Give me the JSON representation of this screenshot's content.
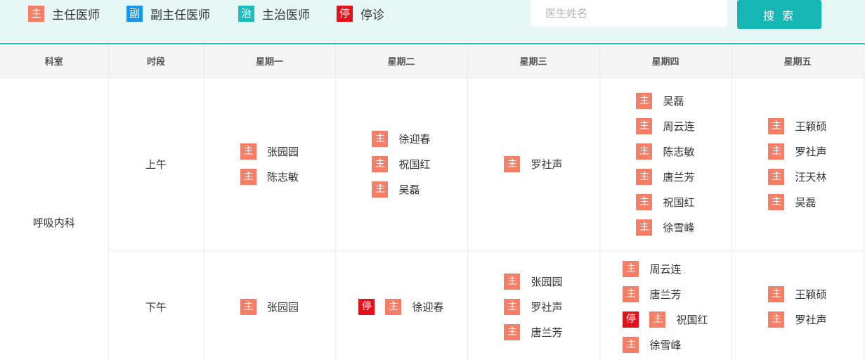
{
  "legend": [
    {
      "badge": "主",
      "label": "主任医师",
      "color": "#f67e66"
    },
    {
      "badge": "副",
      "label": "副主任医师",
      "color": "#1a96e6"
    },
    {
      "badge": "治",
      "label": "主治医师",
      "color": "#1bbdbd"
    },
    {
      "badge": "停",
      "label": "停诊",
      "color": "#e0121a"
    }
  ],
  "search": {
    "placeholder": "医生姓名",
    "value": "",
    "button_label": "搜 索"
  },
  "table": {
    "headers": [
      "科室",
      "时段",
      "星期一",
      "星期二",
      "星期三",
      "星期四",
      "星期五"
    ],
    "department": "呼吸内科",
    "rows": [
      {
        "period": "上午",
        "days": [
          [
            {
              "badges": [
                "主"
              ],
              "name": "张园园"
            },
            {
              "badges": [
                "主"
              ],
              "name": "陈志敏"
            }
          ],
          [
            {
              "badges": [
                "主"
              ],
              "name": "徐迎春"
            },
            {
              "badges": [
                "主"
              ],
              "name": "祝国红"
            },
            {
              "badges": [
                "主"
              ],
              "name": "吴磊"
            }
          ],
          [
            {
              "badges": [
                "主"
              ],
              "name": "罗社声"
            }
          ],
          [
            {
              "badges": [
                "主"
              ],
              "name": "吴磊"
            },
            {
              "badges": [
                "主"
              ],
              "name": "周云连"
            },
            {
              "badges": [
                "主"
              ],
              "name": "陈志敏"
            },
            {
              "badges": [
                "主"
              ],
              "name": "唐兰芳"
            },
            {
              "badges": [
                "主"
              ],
              "name": "祝国红"
            },
            {
              "badges": [
                "主"
              ],
              "name": "徐雪峰"
            }
          ],
          [
            {
              "badges": [
                "主"
              ],
              "name": "王颖硕"
            },
            {
              "badges": [
                "主"
              ],
              "name": "罗社声"
            },
            {
              "badges": [
                "主"
              ],
              "name": "汪天林"
            },
            {
              "badges": [
                "主"
              ],
              "name": "吴磊"
            }
          ]
        ]
      },
      {
        "period": "下午",
        "days": [
          [
            {
              "badges": [
                "主"
              ],
              "name": "张园园"
            }
          ],
          [
            {
              "badges": [
                "停",
                "主"
              ],
              "name": "徐迎春"
            }
          ],
          [
            {
              "badges": [
                "主"
              ],
              "name": "张园园"
            },
            {
              "badges": [
                "主"
              ],
              "name": "罗社声"
            },
            {
              "badges": [
                "主"
              ],
              "name": "唐兰芳"
            }
          ],
          [
            {
              "badges": [
                "主"
              ],
              "name": "周云连"
            },
            {
              "badges": [
                "主"
              ],
              "name": "唐兰芳"
            },
            {
              "badges": [
                "停",
                "主"
              ],
              "name": "祝国红"
            },
            {
              "badges": [
                "主"
              ],
              "name": "徐雪峰"
            }
          ],
          [
            {
              "badges": [
                "主"
              ],
              "name": "王颖硕"
            },
            {
              "badges": [
                "主"
              ],
              "name": "罗社声"
            }
          ]
        ]
      }
    ]
  },
  "colors": {
    "topbar_bg": "#e6f7f6",
    "accent": "#14b7b4",
    "badge_zhu": "#f67e66",
    "badge_ting": "#e0121a",
    "badge_fu": "#1a96e6",
    "badge_zhi": "#1bbdbd"
  }
}
